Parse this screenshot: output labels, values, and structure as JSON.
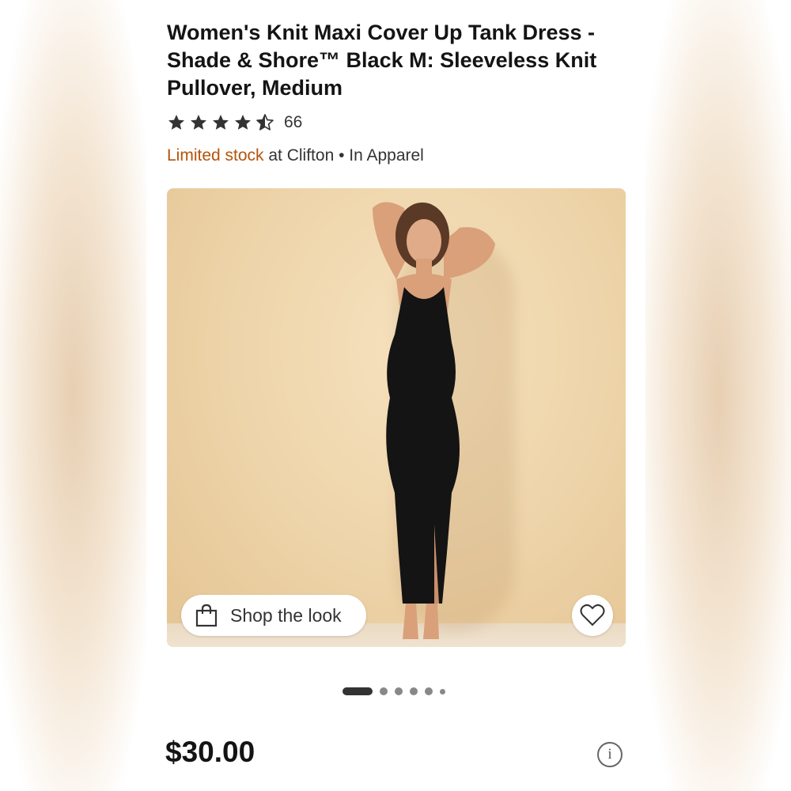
{
  "product": {
    "title": "Women's Knit Maxi Cover Up Tank Dress - Shade & Shore™ Black M: Sleeveless Knit Pullover, Medium",
    "rating": 4.5,
    "rating_max": 5,
    "review_count": "66",
    "price": "$30.00"
  },
  "availability": {
    "stock_status": "Limited stock",
    "location_text": " at Clifton • In Apparel"
  },
  "gallery": {
    "shop_the_look_label": "Shop the look",
    "image_count": 6,
    "active_index": 0
  },
  "icons": {
    "rating": "star-icon",
    "shop": "shopping-bag-icon",
    "favorite": "heart-icon",
    "info": "info-icon"
  },
  "colors": {
    "stock_status": "#b5530a",
    "text_primary": "#141414",
    "dot_active": "#333333"
  }
}
